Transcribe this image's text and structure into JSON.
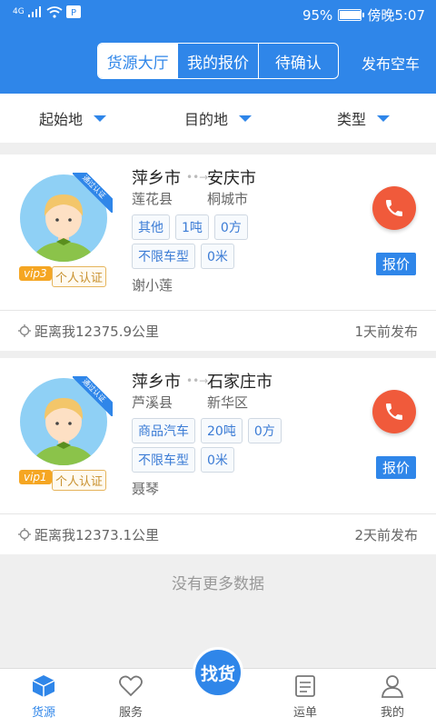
{
  "status_bar": {
    "network": "4G",
    "battery": "95%",
    "time": "傍晚5:07",
    "battery_level": 0.95
  },
  "header": {
    "tabs": [
      {
        "label": "货源大厅",
        "active": true
      },
      {
        "label": "我的报价",
        "active": false
      },
      {
        "label": "待确认",
        "active": false
      }
    ],
    "publish_label": "发布空车"
  },
  "filters": [
    {
      "label": "起始地"
    },
    {
      "label": "目的地"
    },
    {
      "label": "类型"
    }
  ],
  "listings": [
    {
      "badge": "通过认证",
      "vip": "vip3",
      "cert": "个人认证",
      "origin_city": "萍乡市",
      "origin_county": "莲花县",
      "dest_city": "安庆市",
      "dest_county": "桐城市",
      "tags_row1": [
        "其他",
        "1吨",
        "0方"
      ],
      "tags_row2": [
        "不限车型",
        "0米"
      ],
      "person": "谢小莲",
      "quote_label": "报价",
      "distance": "距离我12375.9公里",
      "posted": "1天前发布"
    },
    {
      "badge": "通过认证",
      "vip": "vip1",
      "cert": "个人认证",
      "origin_city": "萍乡市",
      "origin_county": "芦溪县",
      "dest_city": "石家庄市",
      "dest_county": "新华区",
      "tags_row1": [
        "商品汽车",
        "20吨",
        "0方"
      ],
      "tags_row2": [
        "不限车型",
        "0米"
      ],
      "person": "聂琴",
      "quote_label": "报价",
      "distance": "距离我12373.1公里",
      "posted": "2天前发布"
    }
  ],
  "no_more": "没有更多数据",
  "tabbar": {
    "items": [
      {
        "label": "货源",
        "icon": "cube-icon",
        "active": true
      },
      {
        "label": "服务",
        "icon": "heart-icon",
        "active": false
      },
      {
        "label": "运单",
        "icon": "document-icon",
        "active": false
      },
      {
        "label": "我的",
        "icon": "user-icon",
        "active": false
      }
    ],
    "center_label": "找货"
  },
  "colors": {
    "primary": "#2f86e9",
    "call": "#f05a3b",
    "vip": "#f5a623"
  }
}
